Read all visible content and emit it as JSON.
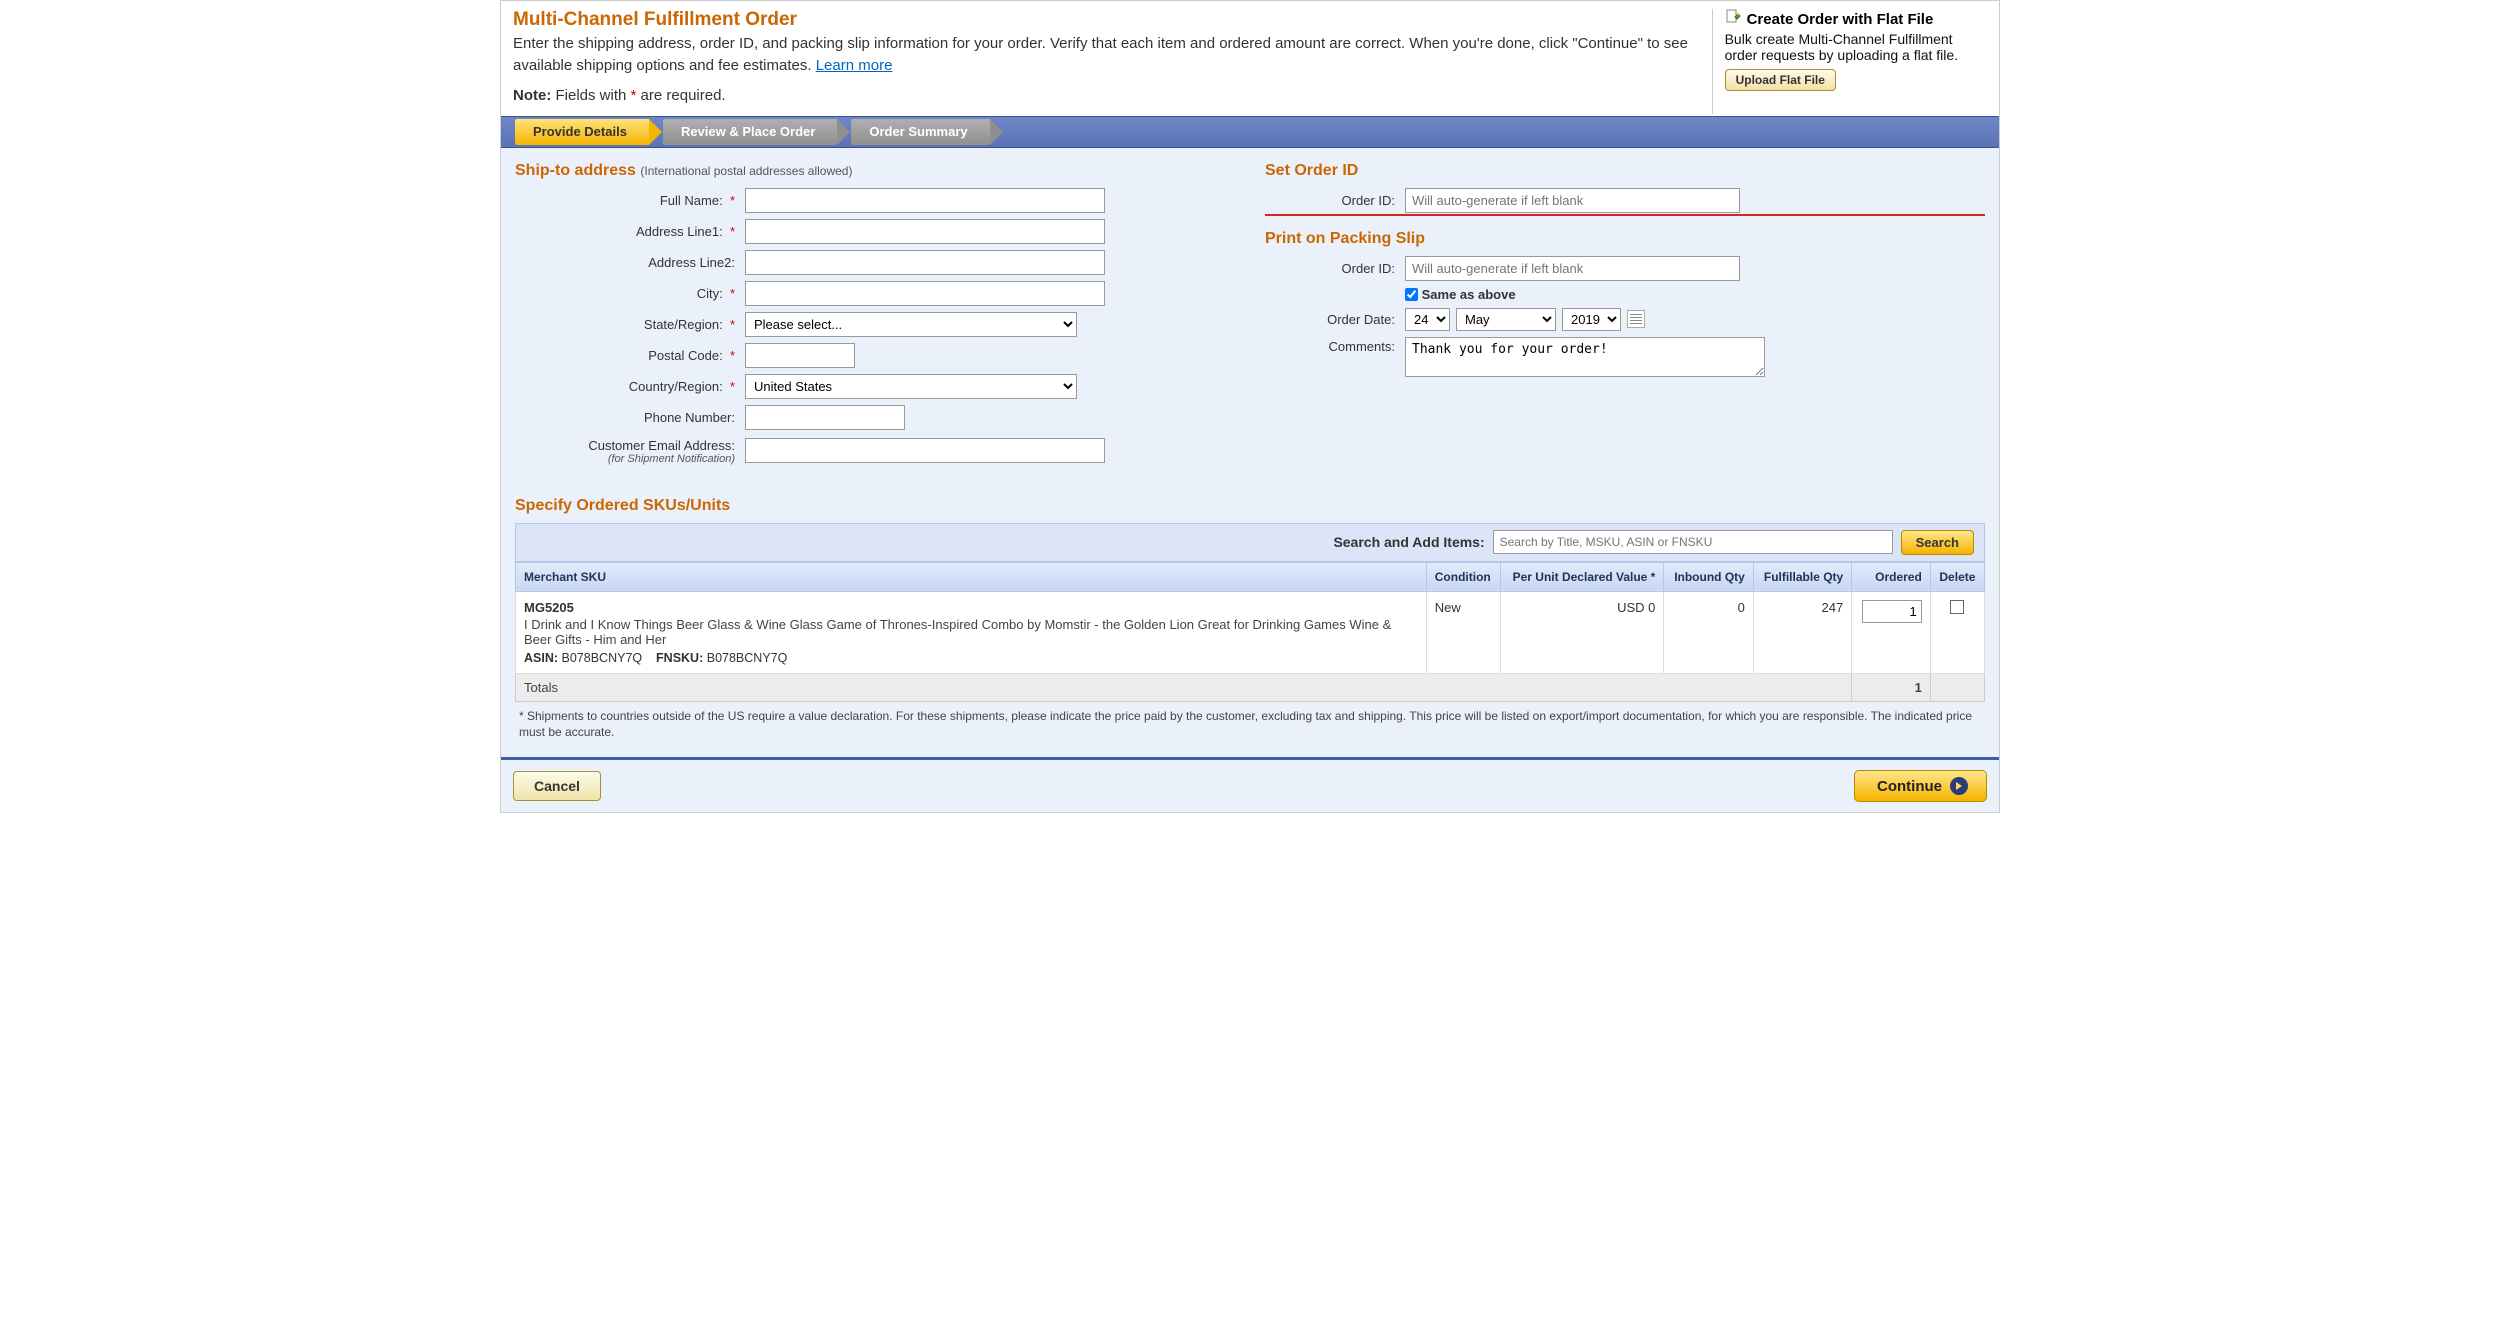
{
  "header": {
    "title": "Multi-Channel Fulfillment Order",
    "intro_a": "Enter the shipping address, order ID, and packing slip information for your order. Verify that each item and ordered amount are correct. When you're done, click \"Continue\" to see available shipping options and fee estimates. ",
    "learn_more": "Learn more",
    "note_label": "Note:",
    "note_text": " Fields with ",
    "note_tail": " are required.",
    "asterisk": "*"
  },
  "flatfile": {
    "title": "Create Order with Flat File",
    "desc": "Bulk create Multi-Channel Fulfillment order requests by uploading a flat file.",
    "button": "Upload Flat File"
  },
  "steps": {
    "s1": "Provide Details",
    "s2": "Review & Place Order",
    "s3": "Order Summary"
  },
  "shipto": {
    "title": "Ship-to address",
    "sub": "(International postal addresses allowed)",
    "full_name": "Full Name:",
    "addr1": "Address Line1:",
    "addr2": "Address Line2:",
    "city": "City:",
    "state": "State/Region:",
    "state_placeholder": "Please select...",
    "postal": "Postal Code:",
    "country": "Country/Region:",
    "country_value": "United States",
    "phone": "Phone Number:",
    "email": "Customer Email Address:",
    "email_hint": "(for Shipment Notification)"
  },
  "order": {
    "set_title": "Set Order ID",
    "order_id_label": "Order ID:",
    "order_id_placeholder": "Will auto-generate if left blank",
    "packing_title": "Print on Packing Slip",
    "same_as_above": "Same as above",
    "order_date_label": "Order Date:",
    "date_day": "24",
    "date_month": "May",
    "date_year": "2019",
    "comments_label": "Comments:",
    "comments_value": "Thank you for your order!"
  },
  "skus": {
    "title": "Specify Ordered SKUs/Units",
    "search_label": "Search and Add Items:",
    "search_placeholder": "Search by Title, MSKU, ASIN or FNSKU",
    "search_button": "Search",
    "cols": {
      "msku": "Merchant SKU",
      "cond": "Condition",
      "declared": "Per Unit Declared Value *",
      "inbound": "Inbound Qty",
      "fulfillable": "Fulfillable Qty",
      "ordered": "Ordered",
      "delete": "Delete"
    },
    "row": {
      "msku": "MG5205",
      "desc": "I Drink and I Know Things Beer Glass & Wine Glass Game of Thrones-Inspired Combo by Momstir - the Golden Lion Great for Drinking Games Wine & Beer Gifts - Him and Her",
      "asin_label": "ASIN:",
      "asin": "B078BCNY7Q",
      "fnsku_label": "FNSKU:",
      "fnsku": "B078BCNY7Q",
      "condition": "New",
      "declared": "USD 0",
      "inbound": "0",
      "fulfillable": "247",
      "ordered": "1"
    },
    "totals_label": "Totals",
    "totals_value": "1",
    "footnote": "* Shipments to countries outside of the US require a value declaration. For these shipments, please indicate the price paid by the customer, excluding tax and shipping. This price will be listed on export/import documentation, for which you are responsible. The indicated price must be accurate."
  },
  "footer": {
    "cancel": "Cancel",
    "continue": "Continue"
  }
}
